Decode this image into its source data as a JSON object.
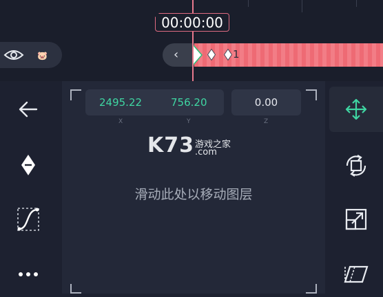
{
  "timeline": {
    "timecode": "00:00:00",
    "clip_label": "1",
    "colors": {
      "playhead": "#e7798c",
      "clip": "#ee6a74",
      "keyframe": "#ffffff"
    }
  },
  "layer": {
    "eye_icon": "eye-icon",
    "thumb_icon": "pig-icon"
  },
  "left_toolbar": [
    "back-arrow-icon",
    "keyframe-diamond-icon",
    "easing-curve-icon",
    "more-icon"
  ],
  "panel": {
    "x_value": "2495.22",
    "y_value": "756.20",
    "z_value": "0.00",
    "x_label": "X",
    "y_label": "Y",
    "z_label": "Z",
    "hint": "滑动此处以移动图层",
    "watermark": {
      "brand": "K73",
      "cn": "游戏之家",
      "com": ".com"
    },
    "colors": {
      "xy_value": "#3fd6a2",
      "z_value": "#e6e8ee"
    }
  },
  "right_toolbar": [
    "move-icon",
    "rotate-icon",
    "scale-icon",
    "skew-icon"
  ]
}
